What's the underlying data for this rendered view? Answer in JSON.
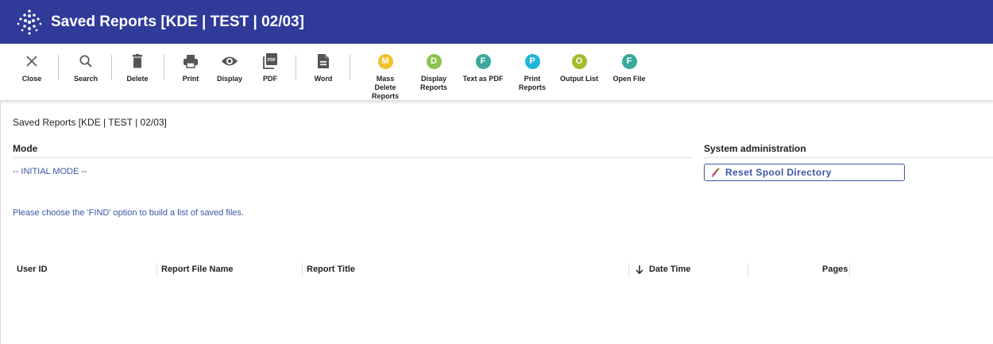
{
  "window": {
    "title": "Saved Reports [KDE | TEST | 02/03]"
  },
  "toolbar": {
    "close": "Close",
    "search": "Search",
    "delete": "Delete",
    "print": "Print",
    "display": "Display",
    "pdf": "PDF",
    "pdf_icon_text": "PDF",
    "word": "Word",
    "mass_delete": {
      "letter": "M",
      "label": "Mass Delete Reports",
      "color": "#f2c12e"
    },
    "display_reports": {
      "letter": "D",
      "label": "Display Reports",
      "color": "#8cc34a"
    },
    "text_as_pdf": {
      "letter": "F",
      "label": "Text as PDF",
      "color": "#3aa89a"
    },
    "print_reports": {
      "letter": "P",
      "label": "Print Reports",
      "color": "#22b6d6"
    },
    "output_list": {
      "letter": "O",
      "label": "Output List",
      "color": "#a3bd2a"
    },
    "open_file": {
      "letter": "F",
      "label": "Open File",
      "color": "#3aa89a"
    }
  },
  "main": {
    "breadcrumb": "Saved Reports [KDE | TEST | 02/03]",
    "mode_heading": "Mode",
    "mode_value": "-- INITIAL MODE --",
    "sysadmin_heading": "System administration",
    "reset_button": "Reset Spool Directory",
    "hint": "Please choose the 'FIND' option to build a list of saved files."
  },
  "table": {
    "columns": {
      "user_id": "User ID",
      "report_file_name": "Report File Name",
      "report_title": "Report Title",
      "date_time": "Date Time",
      "pages": "Pages"
    },
    "sort": {
      "column": "date_time",
      "direction": "descending"
    }
  }
}
